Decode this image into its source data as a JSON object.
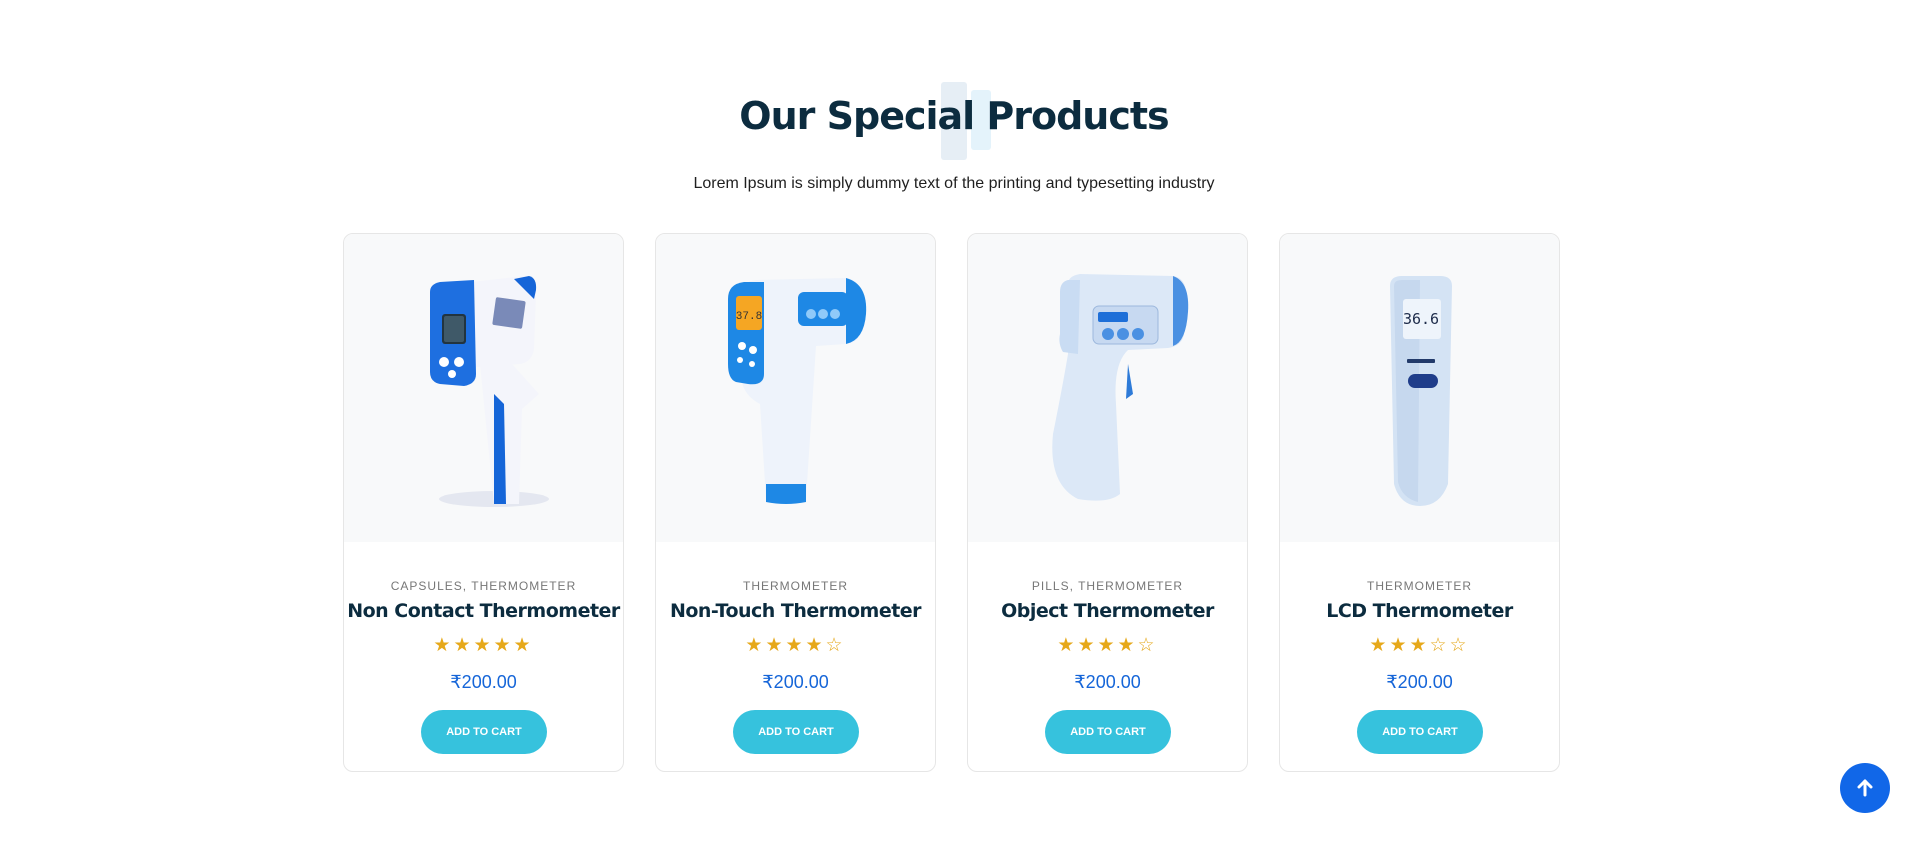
{
  "section": {
    "title": "Our Special Products",
    "subtitle": "Lorem Ipsum is simply dummy text of the printing and typesetting industry"
  },
  "colors": {
    "title": "#0c2c3f",
    "price": "#1565d8",
    "button": "#36c2dd",
    "star": "#e6a81a",
    "scroll_top": "#1167e8"
  },
  "products": [
    {
      "categories": [
        "CAPSULES",
        "THERMOMETER"
      ],
      "name": "Non Contact Thermometer",
      "rating": 5,
      "stars": "★★★★★",
      "price": "₹200.00",
      "button_label": "ADD TO CART",
      "image_icon": "thermometer-gun-blue-icon"
    },
    {
      "categories": [
        "THERMOMETER"
      ],
      "name": "Non-Touch Thermometer",
      "rating": 4,
      "stars": "★★★★☆",
      "price": "₹200.00",
      "button_label": "ADD TO CART",
      "image_icon": "thermometer-gun-display-icon",
      "display_reading": "37.8"
    },
    {
      "categories": [
        "PILLS",
        "THERMOMETER"
      ],
      "name": "Object Thermometer",
      "rating": 4,
      "stars": "★★★★☆",
      "price": "₹200.00",
      "button_label": "ADD TO CART",
      "image_icon": "thermometer-gun-light-icon"
    },
    {
      "categories": [
        "THERMOMETER"
      ],
      "name": "LCD Thermometer",
      "rating": 3,
      "stars": "★★★☆☆",
      "price": "₹200.00",
      "button_label": "ADD TO CART",
      "image_icon": "thermometer-stick-icon",
      "display_reading": "36.6"
    }
  ],
  "scroll_top_icon": "arrow-up-icon"
}
